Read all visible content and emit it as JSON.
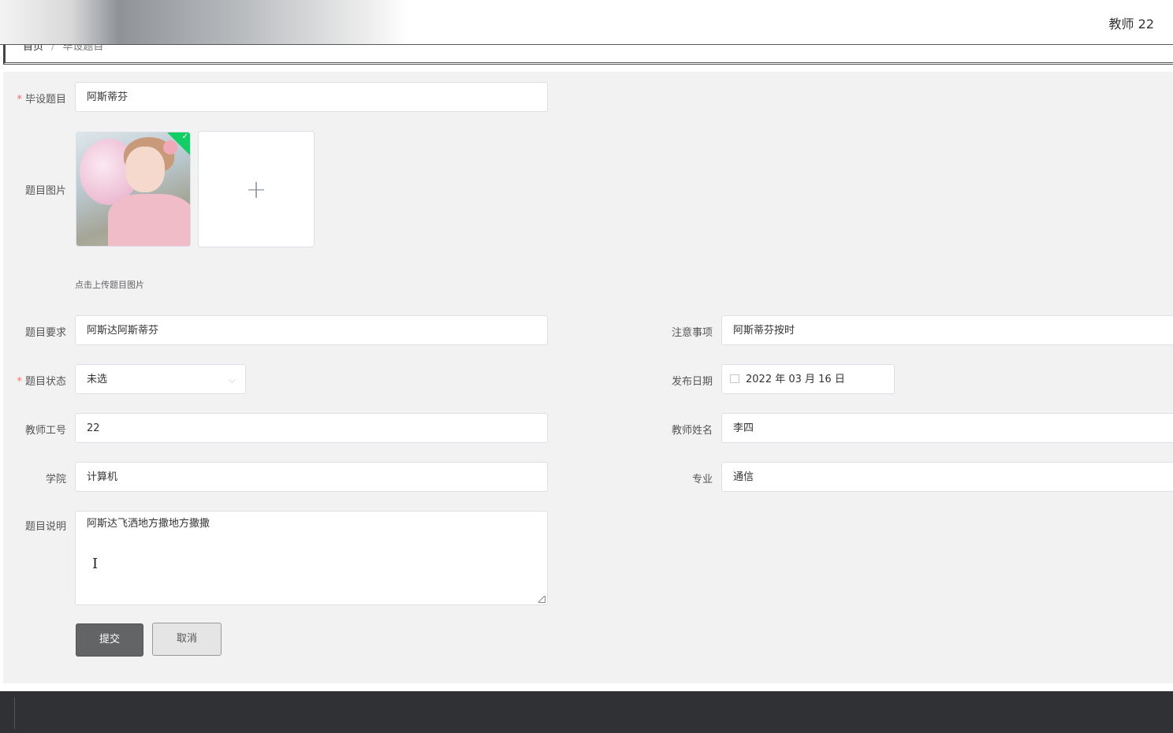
{
  "header": {
    "user": "教师 22"
  },
  "breadcrumb": {
    "home": "首页",
    "separator": "/",
    "current": "毕设题目"
  },
  "form": {
    "topic": {
      "label": "毕设题目",
      "value": "阿斯蒂芬"
    },
    "image": {
      "label": "题目图片",
      "add_icon": "+",
      "tip": "点击上传题目图片"
    },
    "requirement": {
      "label": "题目要求",
      "value": "阿斯达阿斯蒂芬"
    },
    "notes": {
      "label": "注意事项",
      "value": "阿斯蒂芬按时"
    },
    "status": {
      "label": "题目状态",
      "value": "未选",
      "arrow": "⌵"
    },
    "publish_date": {
      "label": "发布日期",
      "value": "2022 年 03 月 16 日"
    },
    "teacher_id": {
      "label": "教师工号",
      "value": "22"
    },
    "teacher_name": {
      "label": "教师姓名",
      "value": "李四"
    },
    "college": {
      "label": "学院",
      "value": "计算机"
    },
    "major": {
      "label": "专业",
      "value": "通信"
    },
    "description": {
      "label": "题目说明",
      "value": "阿斯达飞洒地方撒地方撒撒"
    },
    "required_mark": "*",
    "check_mark": "✓",
    "text_cursor": "I",
    "submit_label": "提交",
    "cancel_label": "取消"
  }
}
